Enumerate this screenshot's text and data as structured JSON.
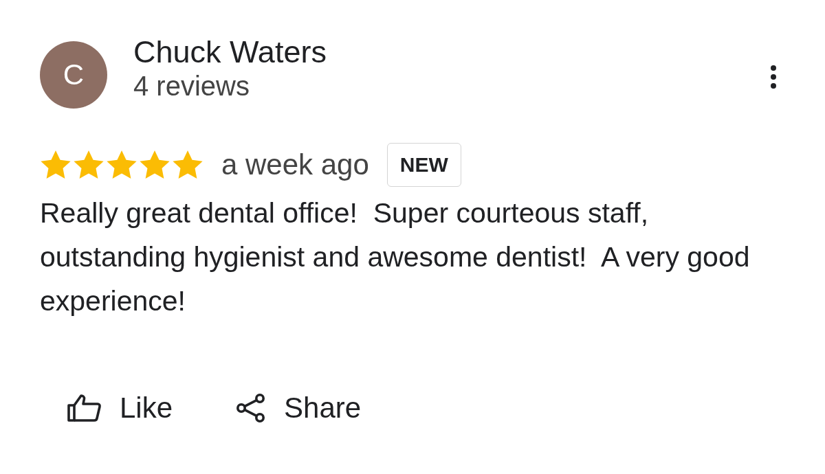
{
  "reviewer": {
    "initial": "C",
    "name": "Chuck Waters",
    "review_count": "4 reviews"
  },
  "review": {
    "stars": 5,
    "time": "a week ago",
    "badge": "NEW",
    "text": "Really great dental office!  Super courteous staff, outstanding hygienist and awesome dentist!  A very good experience!"
  },
  "actions": [
    {
      "kind": "like",
      "label": "Like"
    },
    {
      "kind": "share",
      "label": "Share"
    }
  ]
}
